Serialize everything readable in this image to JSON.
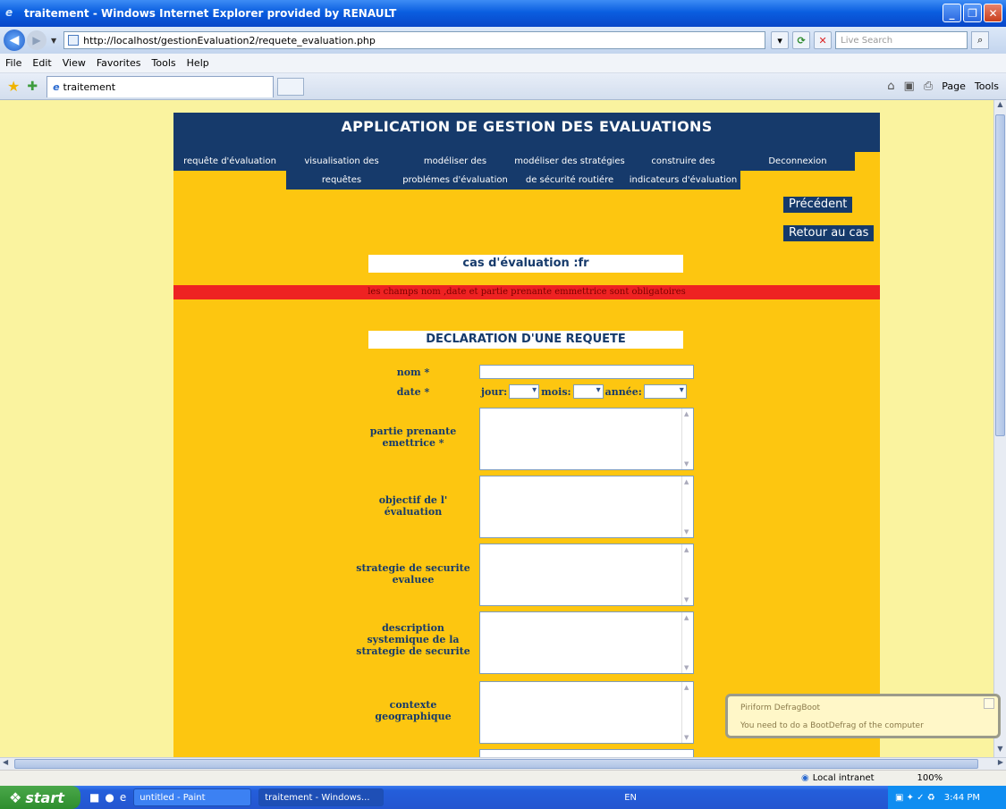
{
  "window": {
    "title": "traitement - Windows Internet Explorer provided by RENAULT"
  },
  "address": {
    "url": "http://localhost/gestionEvaluation2/requete_evaluation.php",
    "search_placeholder": "Live Search"
  },
  "menu": [
    "File",
    "Edit",
    "View",
    "Favorites",
    "Tools",
    "Help"
  ],
  "tabs": {
    "active_label": "traitement",
    "cmd_page": "Page",
    "cmd_tools": "Tools"
  },
  "page": {
    "banner": "APPLICATION DE GESTION DES EVALUATIONS",
    "nav": [
      {
        "line1": "requête d'évaluation",
        "line2": ""
      },
      {
        "line1": "visualisation des",
        "line2": "requêtes"
      },
      {
        "line1": "modéliser des",
        "line2": "problémes d'évaluation"
      },
      {
        "line1": "modéliser des stratégies",
        "line2": "de sécurité routiére"
      },
      {
        "line1": "construire des",
        "line2": "indicateurs d'évaluation"
      },
      {
        "line1": "Deconnexion",
        "line2": ""
      }
    ],
    "btn_prev": "Précédent",
    "btn_back": "Retour au cas",
    "case_title": "cas d'évaluation :fr",
    "error_msg": "les champs nom ,date et partie prenante emmettrice sont obligatoires",
    "form_title": "DECLARATION D'UNE REQUETE",
    "labels": {
      "nom": "nom *",
      "date": "date *",
      "jour": "jour:",
      "mois": "mois:",
      "annee": "année:",
      "partie_1": "partie prenante",
      "partie_2": "emettrice *",
      "objectif_1": "objectif de l'",
      "objectif_2": "évaluation",
      "strategie_1": "strategie de securite",
      "strategie_2": "evaluee",
      "description_1": "description",
      "description_2": "systemique de la",
      "description_3": "strategie de securite",
      "contexte_1": "contexte",
      "contexte_2": "geographique"
    },
    "values": {
      "nom": "",
      "jour": "",
      "mois": "",
      "annee": ""
    }
  },
  "balloon": {
    "title": "Piriform DefragBoot",
    "message": "You need to do a BootDefrag of the computer"
  },
  "status": {
    "zone": "Local intranet",
    "zoom": "100%"
  },
  "taskbar": {
    "start": "start",
    "tasks": [
      "untitled - Paint",
      "traitement - Windows..."
    ],
    "lang": "EN",
    "time": "3:44 PM"
  }
}
